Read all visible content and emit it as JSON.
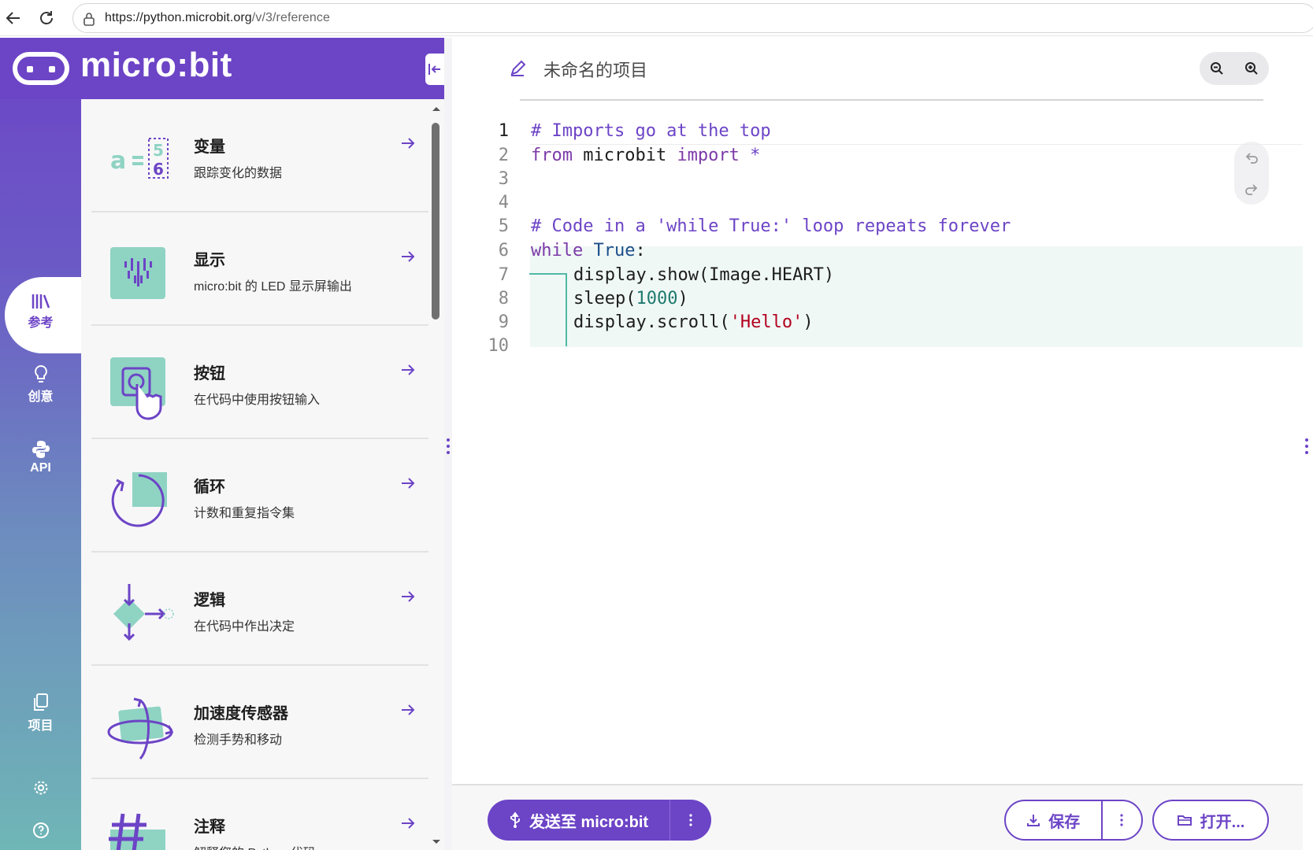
{
  "browser": {
    "url_host": "https://python.microbit.org",
    "url_path": "/v/3/reference"
  },
  "brand": {
    "name": "micro:bit"
  },
  "rail": {
    "items": [
      {
        "id": "reference",
        "label": "参考",
        "icon": "library-icon",
        "active": true
      },
      {
        "id": "ideas",
        "label": "创意",
        "icon": "lightbulb-icon",
        "active": false
      },
      {
        "id": "api",
        "label": "API",
        "icon": "python-icon",
        "active": false
      },
      {
        "id": "project",
        "label": "项目",
        "icon": "files-icon",
        "active": false
      },
      {
        "id": "settings",
        "label": "",
        "icon": "gear-icon",
        "active": false
      },
      {
        "id": "help",
        "label": "",
        "icon": "help-icon",
        "active": false
      }
    ]
  },
  "reference": {
    "items": [
      {
        "title": "变量",
        "desc": "跟踪变化的数据",
        "icon": "variables-icon"
      },
      {
        "title": "显示",
        "desc": "micro:bit 的 LED 显示屏输出",
        "icon": "display-icon"
      },
      {
        "title": "按钮",
        "desc": "在代码中使用按钮输入",
        "icon": "buttons-icon"
      },
      {
        "title": "循环",
        "desc": "计数和重复指令集",
        "icon": "loops-icon"
      },
      {
        "title": "逻辑",
        "desc": "在代码中作出决定",
        "icon": "logic-icon"
      },
      {
        "title": "加速度传感器",
        "desc": "检测手势和移动",
        "icon": "accelerometer-icon"
      },
      {
        "title": "注释",
        "desc": "解释您的 Python 代码",
        "icon": "comments-icon"
      }
    ]
  },
  "editor": {
    "project_name": "未命名的项目",
    "lines": [
      {
        "n": "1"
      },
      {
        "n": "2"
      },
      {
        "n": "3"
      },
      {
        "n": "4"
      },
      {
        "n": "5"
      },
      {
        "n": "6"
      },
      {
        "n": "7"
      },
      {
        "n": "8"
      },
      {
        "n": "9"
      },
      {
        "n": "10"
      }
    ],
    "code": {
      "l1": "# Imports go at the top",
      "l2_kw": "from",
      "l2_mod": " microbit ",
      "l2_kw2": "import",
      "l2_star": " *",
      "l5": "# Code in a 'while True:' loop repeats forever",
      "l6_kw": "while",
      "l6_true": " True",
      "l6_colon": ":",
      "l7": "display.show(Image.HEART)",
      "l8_a": "sleep(",
      "l8_num": "1000",
      "l8_b": ")",
      "l9_a": "display.scroll(",
      "l9_str": "'Hello'",
      "l9_b": ")"
    }
  },
  "actions": {
    "send_label": "发送至 micro:bit",
    "save_label": "保存",
    "open_label": "打开..."
  },
  "colors": {
    "brand": "#6c44c6",
    "accent_teal": "#4fb9a5",
    "icon_teal": "#8fd3c3"
  }
}
